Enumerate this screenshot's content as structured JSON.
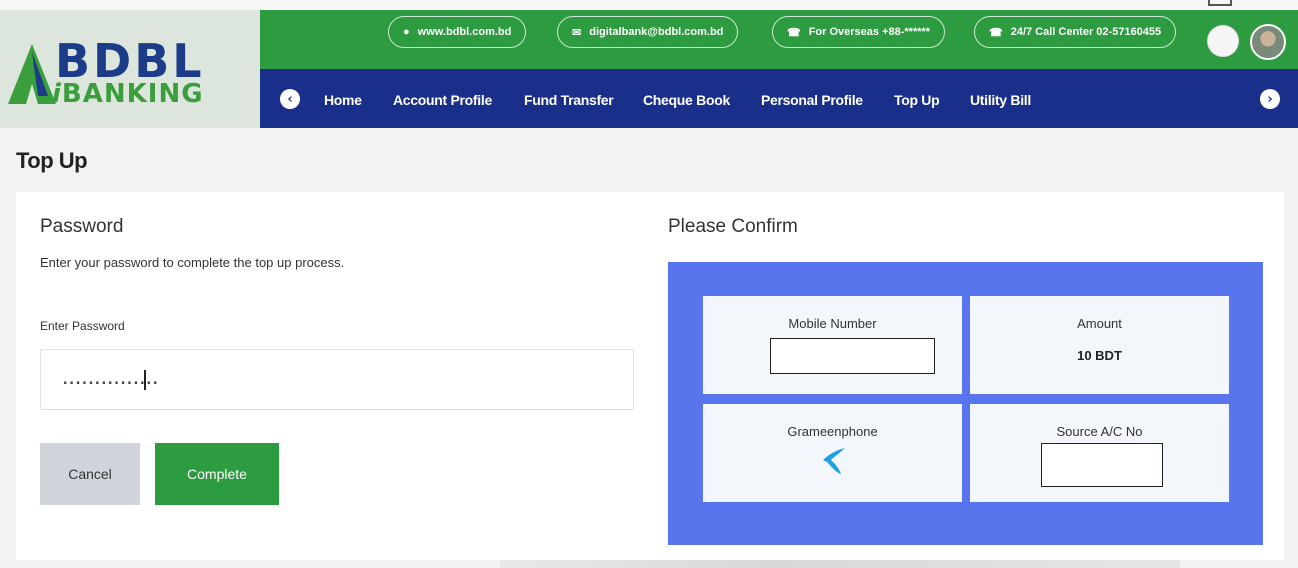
{
  "header": {
    "logo": {
      "line1": "BDBL",
      "line2_prefix": "i",
      "line2_rest": "BANKING"
    },
    "contacts": [
      {
        "icon": "globe-icon",
        "glyph": "●",
        "text": "www.bdbl.com.bd"
      },
      {
        "icon": "mail-icon",
        "glyph": "✉",
        "text": "digitalbank@bdbl.com.bd"
      },
      {
        "icon": "phone-icon",
        "glyph": "☎",
        "text": "For Overseas +88-******"
      },
      {
        "icon": "phone-icon",
        "glyph": "☎",
        "text": "24/7 Call Center 02-57160455"
      }
    ],
    "colors": {
      "green": "#2d9b3f",
      "navy": "#1a2f8a",
      "logo_bg": "#dde6dc"
    }
  },
  "nav": {
    "prev_glyph": "‹",
    "next_glyph": "›",
    "items": [
      "Home",
      "Account Profile",
      "Fund Transfer",
      "Cheque Book",
      "Personal Profile",
      "Top Up",
      "Utility Bill"
    ]
  },
  "page": {
    "title": "Top Up"
  },
  "password_section": {
    "title": "Password",
    "description": "Enter your password to complete the top up process.",
    "label": "Enter Password",
    "value": "...............",
    "cancel_label": "Cancel",
    "complete_label": "Complete"
  },
  "confirm": {
    "title": "Please Confirm",
    "mobile_label": "Mobile Number",
    "amount_label": "Amount",
    "amount_value": "10 BDT",
    "operator_label": "Grameenphone",
    "operator_icon": "grameenphone-logo-icon",
    "source_label": "Source A/C No",
    "panel_color": "#5975ee"
  }
}
